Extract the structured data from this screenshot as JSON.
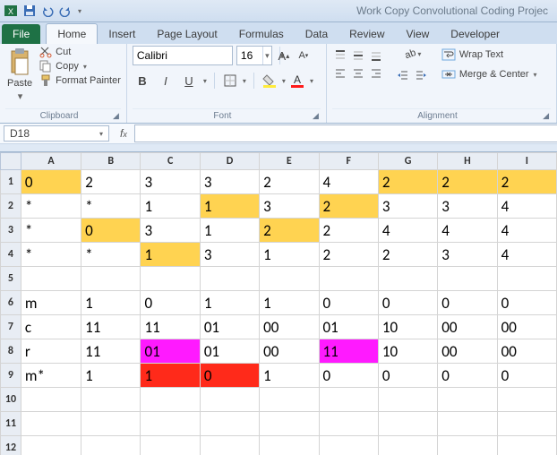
{
  "titlebar": {
    "title": "Work Copy Convolutional Coding Projec"
  },
  "tabs": {
    "file": "File",
    "items": [
      "Home",
      "Insert",
      "Page Layout",
      "Formulas",
      "Data",
      "Review",
      "View",
      "Developer"
    ],
    "active": "Home"
  },
  "ribbon": {
    "clipboard": {
      "label": "Clipboard",
      "paste": "Paste",
      "cut": "Cut",
      "copy": "Copy",
      "format_painter": "Format Painter"
    },
    "font": {
      "label": "Font",
      "name": "Calibri",
      "size": "16"
    },
    "alignment": {
      "label": "Alignment",
      "wrap": "Wrap Text",
      "merge": "Merge & Center"
    }
  },
  "namebox": {
    "ref": "D18"
  },
  "sheet": {
    "cols": [
      "A",
      "B",
      "C",
      "D",
      "E",
      "F",
      "G",
      "H",
      "I"
    ],
    "rows": [
      {
        "n": "1",
        "cells": [
          {
            "v": "0",
            "c": "y"
          },
          {
            "v": "2"
          },
          {
            "v": "3"
          },
          {
            "v": "3"
          },
          {
            "v": "2"
          },
          {
            "v": "4"
          },
          {
            "v": "2",
            "c": "y"
          },
          {
            "v": "2",
            "c": "y"
          },
          {
            "v": "2",
            "c": "y"
          }
        ]
      },
      {
        "n": "2",
        "cells": [
          {
            "v": "*"
          },
          {
            "v": "*"
          },
          {
            "v": "1"
          },
          {
            "v": "1",
            "c": "y"
          },
          {
            "v": "3"
          },
          {
            "v": "2",
            "c": "y"
          },
          {
            "v": "3"
          },
          {
            "v": "3"
          },
          {
            "v": "4"
          }
        ]
      },
      {
        "n": "3",
        "cells": [
          {
            "v": "*"
          },
          {
            "v": "0",
            "c": "y"
          },
          {
            "v": "3"
          },
          {
            "v": "1"
          },
          {
            "v": "2",
            "c": "y"
          },
          {
            "v": "2"
          },
          {
            "v": "4"
          },
          {
            "v": "4"
          },
          {
            "v": "4"
          }
        ]
      },
      {
        "n": "4",
        "cells": [
          {
            "v": "*"
          },
          {
            "v": "*"
          },
          {
            "v": "1",
            "c": "y"
          },
          {
            "v": "3"
          },
          {
            "v": "1"
          },
          {
            "v": "2"
          },
          {
            "v": "2"
          },
          {
            "v": "3"
          },
          {
            "v": "4"
          }
        ]
      },
      {
        "n": "5",
        "cells": [
          {
            "v": ""
          },
          {
            "v": ""
          },
          {
            "v": ""
          },
          {
            "v": ""
          },
          {
            "v": ""
          },
          {
            "v": ""
          },
          {
            "v": ""
          },
          {
            "v": ""
          },
          {
            "v": ""
          }
        ]
      },
      {
        "n": "6",
        "cells": [
          {
            "v": "m"
          },
          {
            "v": "1"
          },
          {
            "v": "0"
          },
          {
            "v": "1"
          },
          {
            "v": "1"
          },
          {
            "v": "0"
          },
          {
            "v": "0"
          },
          {
            "v": "0"
          },
          {
            "v": "0"
          }
        ]
      },
      {
        "n": "7",
        "cells": [
          {
            "v": "c"
          },
          {
            "v": "11"
          },
          {
            "v": "11"
          },
          {
            "v": "01"
          },
          {
            "v": "00"
          },
          {
            "v": "01"
          },
          {
            "v": "10"
          },
          {
            "v": "00"
          },
          {
            "v": "00"
          }
        ]
      },
      {
        "n": "8",
        "cells": [
          {
            "v": "r"
          },
          {
            "v": "11"
          },
          {
            "v": "01",
            "c": "m"
          },
          {
            "v": "01"
          },
          {
            "v": "00"
          },
          {
            "v": "11",
            "c": "m"
          },
          {
            "v": "10"
          },
          {
            "v": "00"
          },
          {
            "v": "00"
          }
        ]
      },
      {
        "n": "9",
        "cells": [
          {
            "v": "m*"
          },
          {
            "v": "1"
          },
          {
            "v": "1",
            "c": "r"
          },
          {
            "v": "0",
            "c": "r"
          },
          {
            "v": "1"
          },
          {
            "v": "0"
          },
          {
            "v": "0"
          },
          {
            "v": "0"
          },
          {
            "v": "0"
          }
        ]
      },
      {
        "n": "10",
        "cells": [
          {
            "v": ""
          },
          {
            "v": ""
          },
          {
            "v": ""
          },
          {
            "v": ""
          },
          {
            "v": ""
          },
          {
            "v": ""
          },
          {
            "v": ""
          },
          {
            "v": ""
          },
          {
            "v": ""
          }
        ]
      },
      {
        "n": "11",
        "cells": [
          {
            "v": ""
          },
          {
            "v": ""
          },
          {
            "v": ""
          },
          {
            "v": ""
          },
          {
            "v": ""
          },
          {
            "v": ""
          },
          {
            "v": ""
          },
          {
            "v": ""
          },
          {
            "v": ""
          }
        ]
      },
      {
        "n": "12",
        "cells": [
          {
            "v": ""
          },
          {
            "v": ""
          },
          {
            "v": ""
          },
          {
            "v": ""
          },
          {
            "v": ""
          },
          {
            "v": ""
          },
          {
            "v": ""
          },
          {
            "v": ""
          },
          {
            "v": ""
          }
        ]
      }
    ]
  }
}
